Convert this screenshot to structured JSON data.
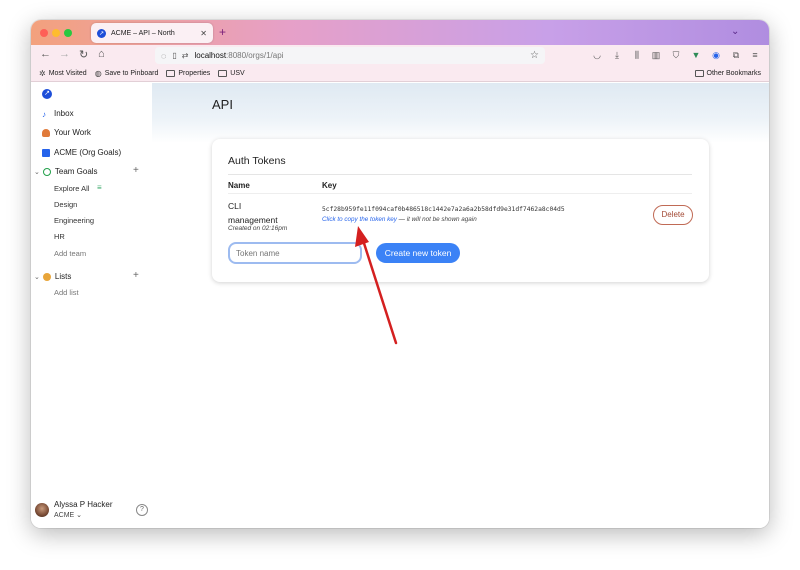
{
  "browser": {
    "tab_title": "ACME – API – North",
    "url_host": "localhost",
    "url_path": ":8080/orgs/1/api",
    "bookmarks": [
      "Most Visited",
      "Save to Pinboard",
      "Properties",
      "USV"
    ],
    "other_bookmarks": "Other Bookmarks"
  },
  "sidebar": {
    "inbox": "Inbox",
    "your_work": "Your Work",
    "org_goals": "ACME (Org Goals)",
    "team_goals": "Team Goals",
    "team_items": [
      "Explore All",
      "Design",
      "Engineering",
      "HR"
    ],
    "add_team": "Add team",
    "lists": "Lists",
    "add_list": "Add list",
    "user_name": "Alyssa P Hacker",
    "user_org": "ACME"
  },
  "page": {
    "title": "API",
    "card_title": "Auth Tokens",
    "col_name": "Name",
    "col_key": "Key",
    "token": {
      "name": "CLI management",
      "created": "Created on 02:16pm",
      "key": "5cf28b959fe11f094caf0b486518c1442e7a2a6a2b58dfd9e31df7462a8c04d5",
      "copy_link": "Click to copy the token key",
      "copy_note": " — it will not be shown again",
      "delete_label": "Delete"
    },
    "input_placeholder": "Token name",
    "create_label": "Create new token"
  },
  "colors": {
    "accent": "#3b82f6",
    "delete": "#a34a35",
    "annotation_arrow": "#d42020"
  }
}
